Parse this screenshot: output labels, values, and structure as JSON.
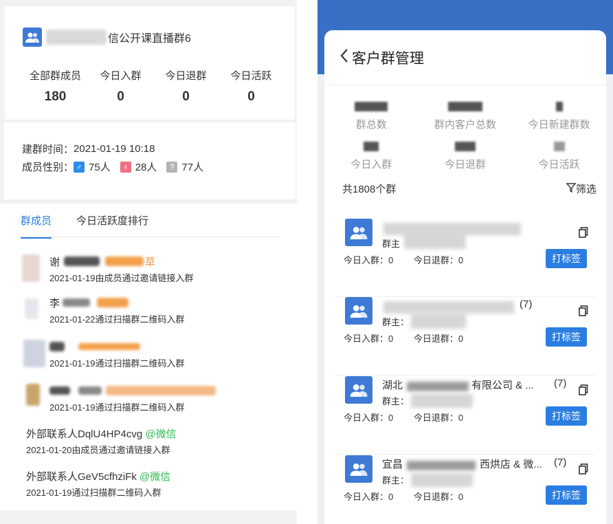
{
  "left": {
    "group_title_suffix": "信公开课直播群6",
    "stats": [
      {
        "label": "全部群成员",
        "value": "180"
      },
      {
        "label": "今日入群",
        "value": "0"
      },
      {
        "label": "今日退群",
        "value": "0"
      },
      {
        "label": "今日活跃",
        "value": "0"
      }
    ],
    "created_label": "建群时间：",
    "created_value": "2021-01-19 10:18",
    "gender_label": "成员性别：",
    "male_count": "75人",
    "female_count": "28人",
    "unknown_count": "77人",
    "tabs": [
      "群成员",
      "今日活跃度排行"
    ],
    "members": [
      {
        "name": "谢",
        "name_tail": "草",
        "sub": "2021-01-19由成员通过邀请链接入群"
      },
      {
        "name": "李",
        "name_tail": "",
        "sub": "2021-01-22通过扫描群二维码入群"
      },
      {
        "name": "",
        "name_tail": "",
        "sub": "2021-01-19通过扫描群二维码入群"
      },
      {
        "name": "",
        "name_tail": "",
        "sub": "2021-01-19通过扫描群二维码入群"
      },
      {
        "name": "外部联系人DqlU4HP4cvg",
        "wx": "@微信",
        "sub": "2021-01-20由成员通过邀请链接入群"
      },
      {
        "name": "外部联系人GeV5cfhziFk",
        "wx": "@微信",
        "sub": "2021-01-19通过扫描群二维码入群"
      }
    ]
  },
  "right": {
    "nav_title": "客户群管理",
    "kpis": [
      {
        "label": "群总数"
      },
      {
        "label": "群内客户总数"
      },
      {
        "label": "今日新建群数"
      },
      {
        "label": "今日入群"
      },
      {
        "label": "今日退群"
      },
      {
        "label": "今日活跃"
      }
    ],
    "total": "共1808个群",
    "filter_label": "筛选",
    "groups": [
      {
        "title": "",
        "count": "",
        "owner": "群主",
        "in": "今日入群：0",
        "out": "今日退群：0",
        "btn": "打标签"
      },
      {
        "title": "",
        "count": "(7)",
        "owner": "群主：",
        "in": "今日入群：0",
        "out": "今日退群：0",
        "btn": "打标签"
      },
      {
        "title": "湖北",
        "title_tail": "有限公司 & ...",
        "count": "(7)",
        "owner": "群主：",
        "in": "今日入群：0",
        "out": "今日退群：0",
        "btn": "打标签"
      },
      {
        "title": "宜昌",
        "title_tail": "西烘店 & 微...",
        "count": "(7)",
        "owner": "群主：",
        "in": "今日入群：0",
        "out": "今日退群：0",
        "btn": "打标签"
      }
    ]
  }
}
